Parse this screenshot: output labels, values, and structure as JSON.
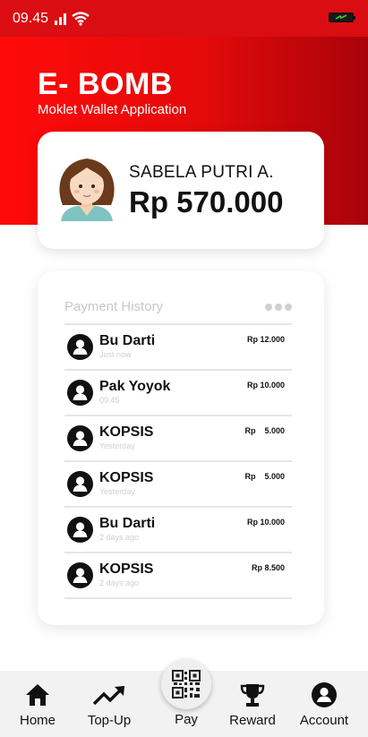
{
  "status_bar": {
    "time": "09.45"
  },
  "header": {
    "title": "E- BOMB",
    "subtitle": "Moklet Wallet Application"
  },
  "profile": {
    "name": "SABELA PUTRI A.",
    "balance": "Rp 570.000"
  },
  "history": {
    "title": "Payment History",
    "transactions": [
      {
        "name": "Bu Darti",
        "time": "Just now",
        "amount": "Rp 12.000"
      },
      {
        "name": "Pak Yoyok",
        "time": "09.45",
        "amount": "Rp 10.000"
      },
      {
        "name": "KOPSIS",
        "time": "Yesterday",
        "amount": "Rp    5.000"
      },
      {
        "name": "KOPSIS",
        "time": "Yesterday",
        "amount": "Rp    5.000"
      },
      {
        "name": "Bu Darti",
        "time": "2 days ago",
        "amount": "Rp 10.000"
      },
      {
        "name": "KOPSIS",
        "time": "2 days ago",
        "amount": "Rp 8.500"
      }
    ]
  },
  "nav": {
    "items": [
      {
        "label": "Home",
        "icon": "home-icon"
      },
      {
        "label": "Top-Up",
        "icon": "trending-up-icon"
      },
      {
        "label": "Pay",
        "icon": "qr-code-icon"
      },
      {
        "label": "Reward",
        "icon": "trophy-icon"
      },
      {
        "label": "Account",
        "icon": "account-icon"
      }
    ]
  },
  "colors": {
    "primary": "#e30a0a",
    "primary_dark": "#a8030a",
    "status_bar": "#d90d12"
  }
}
